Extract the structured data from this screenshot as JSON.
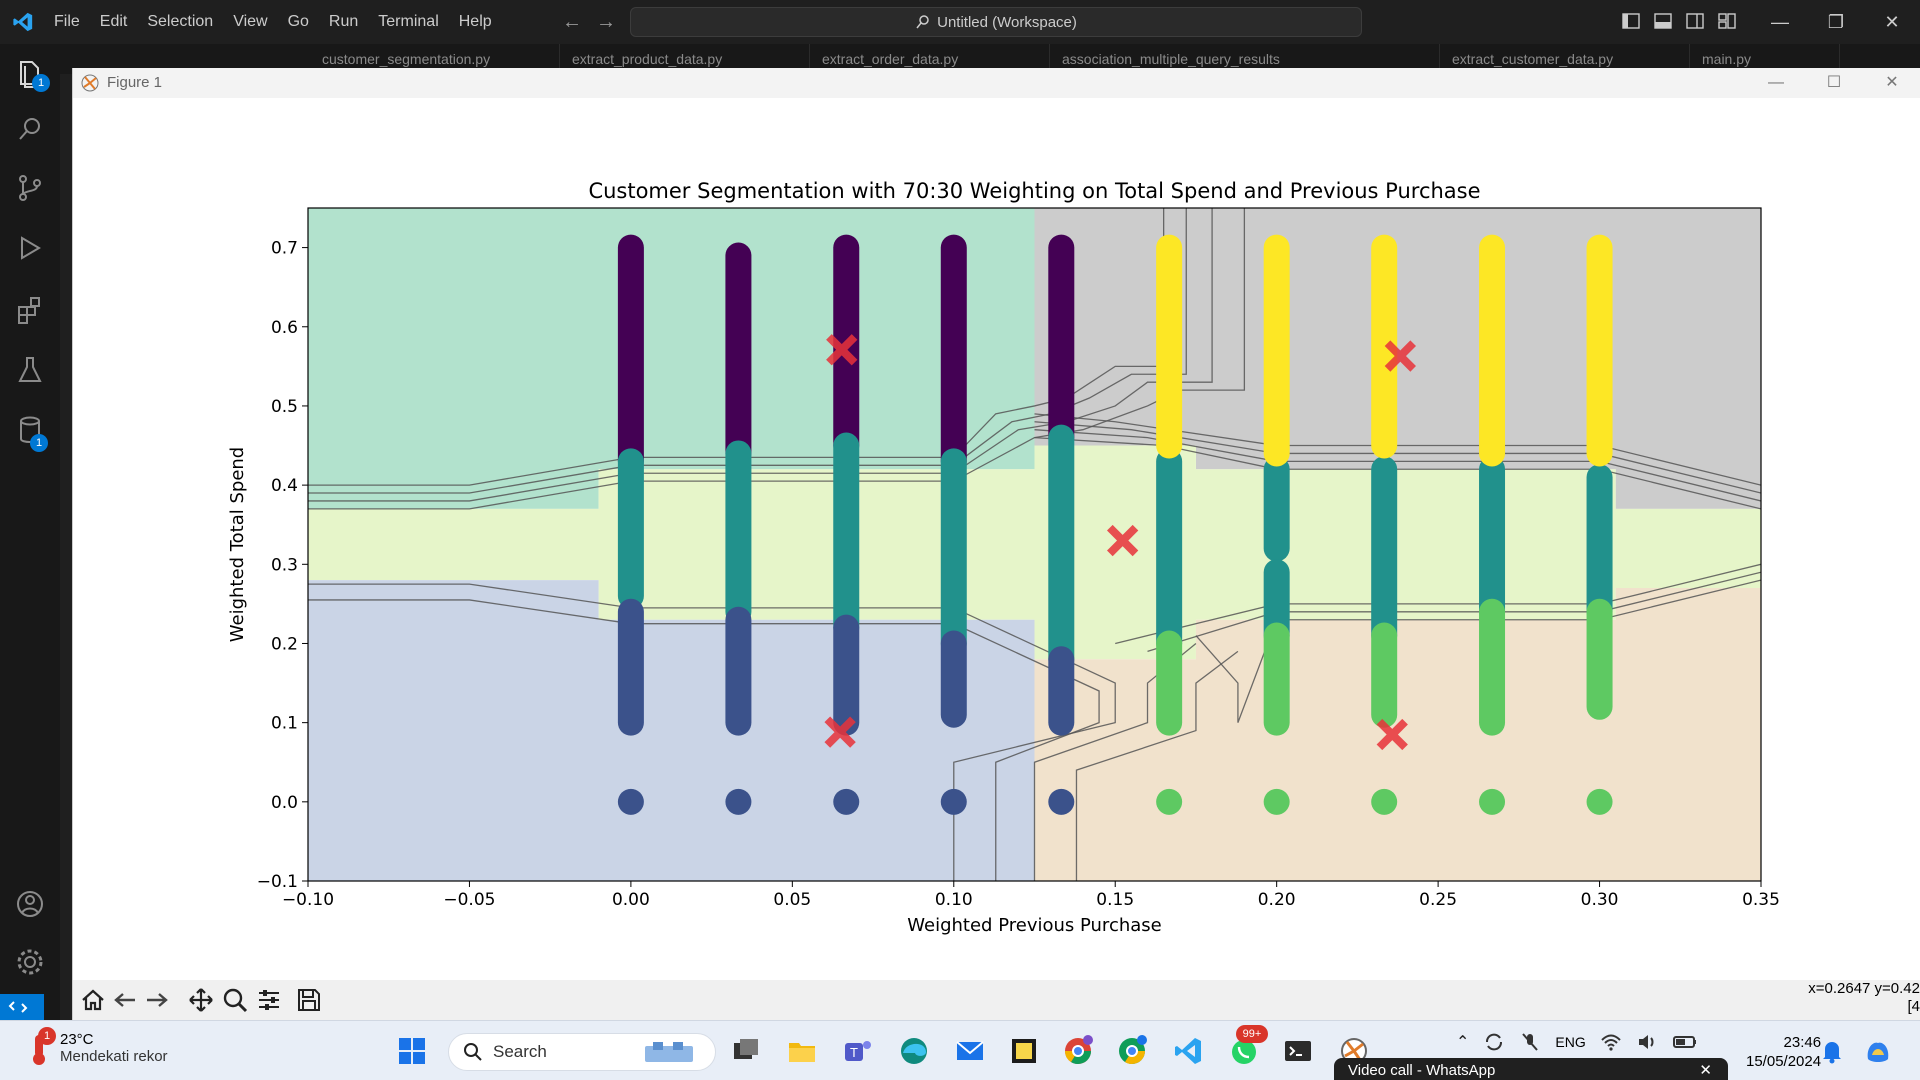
{
  "titlebar": {
    "menu": [
      "File",
      "Edit",
      "Selection",
      "View",
      "Go",
      "Run",
      "Terminal",
      "Help"
    ],
    "command_center": "Untitled (Workspace)"
  },
  "activity_bar": {
    "explorer_badge": "1",
    "remote_badge": "1"
  },
  "tabs": [
    "customer_segmentation.py",
    "extract_product_data.py",
    "extract_order_data.py",
    "association_multiple_query_results",
    "extract_customer_data.py",
    "main.py"
  ],
  "figure_window": {
    "title": "Figure 1",
    "coord_readout": "x=0.2647 y=0.42\n[4"
  },
  "chart_data": {
    "type": "scatter",
    "title": "Customer Segmentation with 70:30 Weighting on Total Spend and Previous Purchase",
    "xlabel": "Weighted Previous Purchase",
    "ylabel": "Weighted Total Spend",
    "xlim": [
      -0.1,
      0.35
    ],
    "ylim": [
      -0.1,
      0.75
    ],
    "xticks": [
      "−0.10",
      "−0.05",
      "0.00",
      "0.05",
      "0.10",
      "0.15",
      "0.20",
      "0.25",
      "0.30",
      "0.35"
    ],
    "xtick_values": [
      -0.1,
      -0.05,
      0.0,
      0.05,
      0.1,
      0.15,
      0.2,
      0.25,
      0.3,
      0.35
    ],
    "yticks": [
      "−0.1",
      "0.0",
      "0.1",
      "0.2",
      "0.3",
      "0.4",
      "0.5",
      "0.6",
      "0.7"
    ],
    "ytick_values": [
      -0.1,
      0.0,
      0.1,
      0.2,
      0.3,
      0.4,
      0.5,
      0.6,
      0.7
    ],
    "grid": false,
    "legend": false,
    "colors": {
      "dark_purple": "#440154",
      "dark_blue": "#3b528b",
      "teal": "#21918c",
      "green": "#5ec962",
      "yellow": "#fde725",
      "centroid": "#e8333a",
      "region_teal": "#b2e2cd",
      "region_blue": "#cad4e6",
      "region_lightgreen": "#e6f5c9",
      "region_gray": "#cccccc",
      "region_peach": "#f1e2cc"
    },
    "clusters": [
      {
        "color": "#440154",
        "segments": [
          [
            0.0,
            0.43,
            0.7
          ],
          [
            0.0333,
            0.44,
            0.69
          ],
          [
            0.0667,
            0.45,
            0.7
          ],
          [
            0.1,
            0.43,
            0.7
          ],
          [
            0.1333,
            0.46,
            0.7
          ]
        ]
      },
      {
        "color": "#21918c",
        "segments": [
          [
            0.0,
            0.26,
            0.43
          ],
          [
            0.0333,
            0.24,
            0.44
          ],
          [
            0.0667,
            0.22,
            0.45
          ],
          [
            0.1,
            0.2,
            0.43
          ],
          [
            0.1333,
            0.18,
            0.46
          ],
          [
            0.1667,
            0.2,
            0.43
          ],
          [
            0.2,
            0.32,
            0.42
          ],
          [
            0.2,
            0.21,
            0.29
          ],
          [
            0.2333,
            0.21,
            0.42
          ],
          [
            0.2667,
            0.24,
            0.42
          ],
          [
            0.3,
            0.24,
            0.41
          ]
        ]
      },
      {
        "color": "#3b528b",
        "segments": [
          [
            0.0,
            0.1,
            0.24
          ],
          [
            0.0333,
            0.1,
            0.23
          ],
          [
            0.0667,
            0.1,
            0.22
          ],
          [
            0.1,
            0.11,
            0.2
          ],
          [
            0.1333,
            0.1,
            0.18
          ]
        ],
        "points": [
          [
            0.0,
            0.0
          ],
          [
            0.0333,
            0.0
          ],
          [
            0.0667,
            0.0
          ],
          [
            0.1,
            0.0
          ],
          [
            0.1333,
            0.0
          ]
        ]
      },
      {
        "color": "#5ec962",
        "segments": [
          [
            0.1667,
            0.1,
            0.2
          ],
          [
            0.2,
            0.1,
            0.21
          ],
          [
            0.2333,
            0.11,
            0.21
          ],
          [
            0.2667,
            0.1,
            0.24
          ],
          [
            0.3,
            0.12,
            0.24
          ]
        ],
        "points": [
          [
            0.1667,
            0.0
          ],
          [
            0.2,
            0.0
          ],
          [
            0.2333,
            0.0
          ],
          [
            0.2667,
            0.0
          ],
          [
            0.3,
            0.0
          ]
        ]
      },
      {
        "color": "#fde725",
        "segments": [
          [
            0.1667,
            0.45,
            0.7
          ],
          [
            0.2,
            0.44,
            0.7
          ],
          [
            0.2333,
            0.45,
            0.7
          ],
          [
            0.2667,
            0.44,
            0.7
          ],
          [
            0.3,
            0.44,
            0.7
          ]
        ]
      }
    ],
    "centroids": [
      [
        0.0653,
        0.571
      ],
      [
        0.2383,
        0.563
      ],
      [
        0.1523,
        0.33
      ],
      [
        0.0648,
        0.088
      ],
      [
        0.2358,
        0.085
      ]
    ],
    "regions": [
      {
        "color": "#b2e2cd",
        "poly": [
          [
            -0.1,
            0.75
          ],
          [
            0.125,
            0.75
          ],
          [
            0.125,
            0.42
          ],
          [
            -0.01,
            0.42
          ],
          [
            -0.01,
            0.37
          ],
          [
            -0.1,
            0.37
          ]
        ]
      },
      {
        "color": "#cccccc",
        "poly": [
          [
            0.125,
            0.75
          ],
          [
            0.35,
            0.75
          ],
          [
            0.35,
            0.37
          ],
          [
            0.305,
            0.37
          ],
          [
            0.305,
            0.42
          ],
          [
            0.175,
            0.42
          ],
          [
            0.175,
            0.45
          ],
          [
            0.125,
            0.45
          ]
        ]
      },
      {
        "color": "#e6f5c9",
        "poly": [
          [
            -0.1,
            0.37
          ],
          [
            -0.01,
            0.37
          ],
          [
            -0.01,
            0.42
          ],
          [
            0.125,
            0.42
          ],
          [
            0.125,
            0.45
          ],
          [
            0.175,
            0.45
          ],
          [
            0.175,
            0.42
          ],
          [
            0.305,
            0.42
          ],
          [
            0.305,
            0.37
          ],
          [
            0.35,
            0.37
          ],
          [
            0.35,
            0.27
          ],
          [
            0.305,
            0.27
          ],
          [
            0.305,
            0.23
          ],
          [
            0.175,
            0.23
          ],
          [
            0.175,
            0.18
          ],
          [
            0.125,
            0.18
          ],
          [
            0.125,
            0.23
          ],
          [
            -0.01,
            0.23
          ],
          [
            -0.01,
            0.28
          ],
          [
            -0.1,
            0.28
          ]
        ]
      },
      {
        "color": "#cad4e6",
        "poly": [
          [
            -0.1,
            0.28
          ],
          [
            -0.01,
            0.28
          ],
          [
            -0.01,
            0.23
          ],
          [
            0.125,
            0.23
          ],
          [
            0.125,
            0.09
          ],
          [
            0.125,
            -0.1
          ],
          [
            -0.1,
            -0.1
          ]
        ]
      },
      {
        "color": "#f1e2cc",
        "poly": [
          [
            0.125,
            -0.1
          ],
          [
            0.35,
            -0.1
          ],
          [
            0.35,
            0.27
          ],
          [
            0.305,
            0.27
          ],
          [
            0.305,
            0.23
          ],
          [
            0.175,
            0.23
          ],
          [
            0.175,
            0.18
          ],
          [
            0.125,
            0.18
          ],
          [
            0.125,
            0.09
          ]
        ]
      }
    ],
    "contours": [
      [
        [
          -0.1,
          0.4
        ],
        [
          -0.05,
          0.4
        ],
        [
          0.0,
          0.435
        ],
        [
          0.1,
          0.435
        ],
        [
          0.113,
          0.49
        ],
        [
          0.125,
          0.5
        ],
        [
          0.135,
          0.51
        ],
        [
          0.15,
          0.55
        ],
        [
          0.165,
          0.55
        ],
        [
          0.165,
          0.75
        ]
      ],
      [
        [
          -0.1,
          0.39
        ],
        [
          -0.05,
          0.39
        ],
        [
          0.0,
          0.425
        ],
        [
          0.1,
          0.425
        ],
        [
          0.118,
          0.48
        ],
        [
          0.13,
          0.49
        ],
        [
          0.142,
          0.51
        ],
        [
          0.155,
          0.54
        ],
        [
          0.172,
          0.54
        ],
        [
          0.172,
          0.75
        ]
      ],
      [
        [
          -0.1,
          0.38
        ],
        [
          -0.05,
          0.38
        ],
        [
          0.0,
          0.415
        ],
        [
          0.1,
          0.415
        ],
        [
          0.12,
          0.47
        ],
        [
          0.135,
          0.48
        ],
        [
          0.15,
          0.5
        ],
        [
          0.16,
          0.53
        ],
        [
          0.18,
          0.53
        ],
        [
          0.18,
          0.75
        ]
      ],
      [
        [
          -0.1,
          0.37
        ],
        [
          -0.05,
          0.37
        ],
        [
          0.0,
          0.405
        ],
        [
          0.1,
          0.405
        ],
        [
          0.125,
          0.46
        ],
        [
          0.14,
          0.47
        ],
        [
          0.16,
          0.5
        ],
        [
          0.17,
          0.52
        ],
        [
          0.19,
          0.52
        ],
        [
          0.19,
          0.75
        ]
      ],
      [
        [
          0.125,
          0.49
        ],
        [
          0.15,
          0.48
        ],
        [
          0.2,
          0.45
        ],
        [
          0.3,
          0.45
        ],
        [
          0.35,
          0.4
        ]
      ],
      [
        [
          0.125,
          0.48
        ],
        [
          0.155,
          0.47
        ],
        [
          0.2,
          0.44
        ],
        [
          0.3,
          0.44
        ],
        [
          0.35,
          0.39
        ]
      ],
      [
        [
          0.125,
          0.47
        ],
        [
          0.16,
          0.46
        ],
        [
          0.2,
          0.43
        ],
        [
          0.3,
          0.43
        ],
        [
          0.35,
          0.38
        ]
      ],
      [
        [
          0.125,
          0.46
        ],
        [
          0.165,
          0.45
        ],
        [
          0.2,
          0.42
        ],
        [
          0.3,
          0.42
        ],
        [
          0.35,
          0.37
        ]
      ],
      [
        [
          -0.1,
          0.275
        ],
        [
          -0.05,
          0.275
        ],
        [
          0.0,
          0.245
        ],
        [
          0.1,
          0.245
        ],
        [
          0.15,
          0.15
        ],
        [
          0.15,
          0.1
        ],
        [
          0.1,
          0.05
        ],
        [
          0.1,
          -0.1
        ]
      ],
      [
        [
          -0.1,
          0.255
        ],
        [
          -0.05,
          0.255
        ],
        [
          0.0,
          0.225
        ],
        [
          0.1,
          0.225
        ],
        [
          0.145,
          0.14
        ],
        [
          0.145,
          0.1
        ],
        [
          0.113,
          0.05
        ],
        [
          0.113,
          -0.1
        ]
      ],
      [
        [
          0.125,
          -0.1
        ],
        [
          0.125,
          0.05
        ],
        [
          0.16,
          0.1
        ],
        [
          0.16,
          0.15
        ],
        [
          0.175,
          0.2
        ]
      ],
      [
        [
          0.138,
          -0.1
        ],
        [
          0.138,
          0.04
        ],
        [
          0.175,
          0.09
        ],
        [
          0.175,
          0.15
        ],
        [
          0.188,
          0.19
        ]
      ],
      [
        [
          0.15,
          0.2
        ],
        [
          0.2,
          0.25
        ],
        [
          0.3,
          0.25
        ],
        [
          0.35,
          0.3
        ]
      ],
      [
        [
          0.16,
          0.19
        ],
        [
          0.2,
          0.24
        ],
        [
          0.3,
          0.24
        ],
        [
          0.35,
          0.29
        ]
      ],
      [
        [
          0.175,
          0.21
        ],
        [
          0.188,
          0.15
        ],
        [
          0.188,
          0.1
        ],
        [
          0.2,
          0.23
        ],
        [
          0.3,
          0.23
        ],
        [
          0.35,
          0.28
        ]
      ]
    ]
  },
  "taskbar": {
    "weather_temp": "23°C",
    "weather_desc": "Mendekati rekor",
    "weather_badge": "1",
    "search_placeholder": "Search",
    "whatsapp_badge": "99+",
    "lang_line1": "ENG",
    "lang_line2": "",
    "time": "23:46",
    "date": "15/05/2024",
    "toast_text": "Video call - WhatsApp"
  }
}
